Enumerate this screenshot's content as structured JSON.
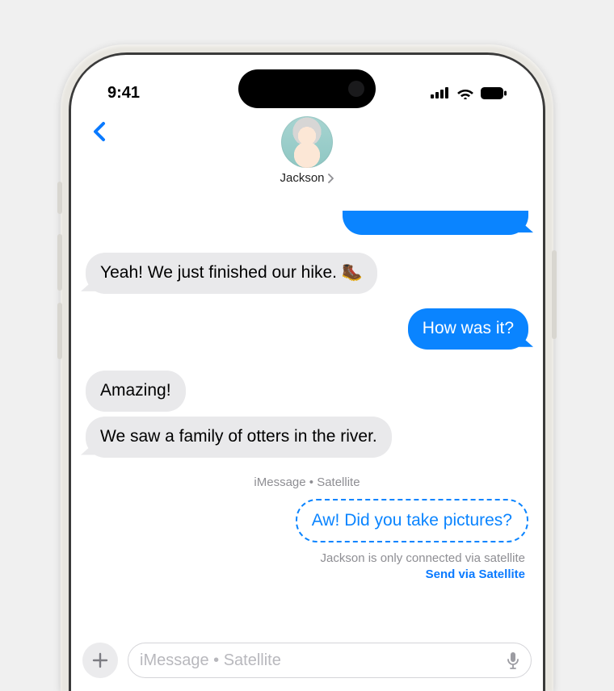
{
  "status": {
    "time": "9:41"
  },
  "contact": {
    "name": "Jackson"
  },
  "messages": {
    "m1": "Yeah! We just finished our hike. 🥾",
    "m2": "How was it?",
    "m3": "Amazing!",
    "m4": "We saw a family of otters in the river.",
    "meta": "iMessage • Satellite",
    "m5": "Aw! Did you take pictures?"
  },
  "satellite": {
    "note": "Jackson is only connected via satellite",
    "action": "Send via Satellite"
  },
  "composer": {
    "placeholder": "iMessage • Satellite"
  }
}
